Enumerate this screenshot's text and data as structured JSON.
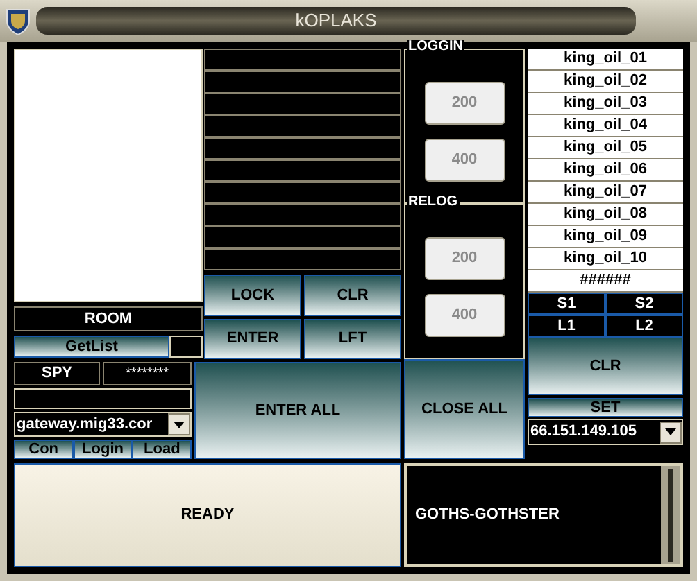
{
  "window": {
    "title": "kOPLAKS"
  },
  "message_fields": [
    {
      "kind": "field"
    },
    {
      "kind": "field"
    },
    {
      "kind": "field"
    },
    {
      "kind": "field"
    },
    {
      "kind": "field"
    },
    {
      "kind": "field"
    },
    {
      "kind": "field"
    },
    {
      "kind": "field"
    },
    {
      "kind": "field"
    },
    {
      "kind": "field"
    }
  ],
  "room_buttons": [
    "LOCK",
    "CLR",
    "ENTER",
    "LFT"
  ],
  "room": {
    "label": "ROOM",
    "get_list": "GetList"
  },
  "spy": {
    "label": "SPY",
    "password": "********"
  },
  "server": {
    "value": "gateway.mig33.cor"
  },
  "connect_buttons": [
    "Con",
    "Login",
    "Load"
  ],
  "enter_all": "ENTER ALL",
  "groups": [
    {
      "title": "LOGGIN",
      "buttons": [
        {
          "label": "200",
          "disabled": true
        },
        {
          "label": "400",
          "disabled": true
        }
      ]
    },
    {
      "title": "RELOG",
      "buttons": [
        {
          "label": "200",
          "disabled": true
        },
        {
          "label": "400",
          "disabled": true
        }
      ]
    }
  ],
  "close_all": "CLOSE ALL",
  "accounts": [
    "king_oil_01",
    "king_oil_02",
    "king_oil_03",
    "king_oil_04",
    "king_oil_05",
    "king_oil_06",
    "king_oil_07",
    "king_oil_08",
    "king_oil_09",
    "king_oil_10",
    "######"
  ],
  "slots": [
    "S1",
    "S2",
    "L1",
    "L2"
  ],
  "clear": "CLR",
  "set": "SET",
  "ip": {
    "value": "66.151.149.105"
  },
  "status": "READY",
  "output": "GOTHS-GOTHSTER"
}
